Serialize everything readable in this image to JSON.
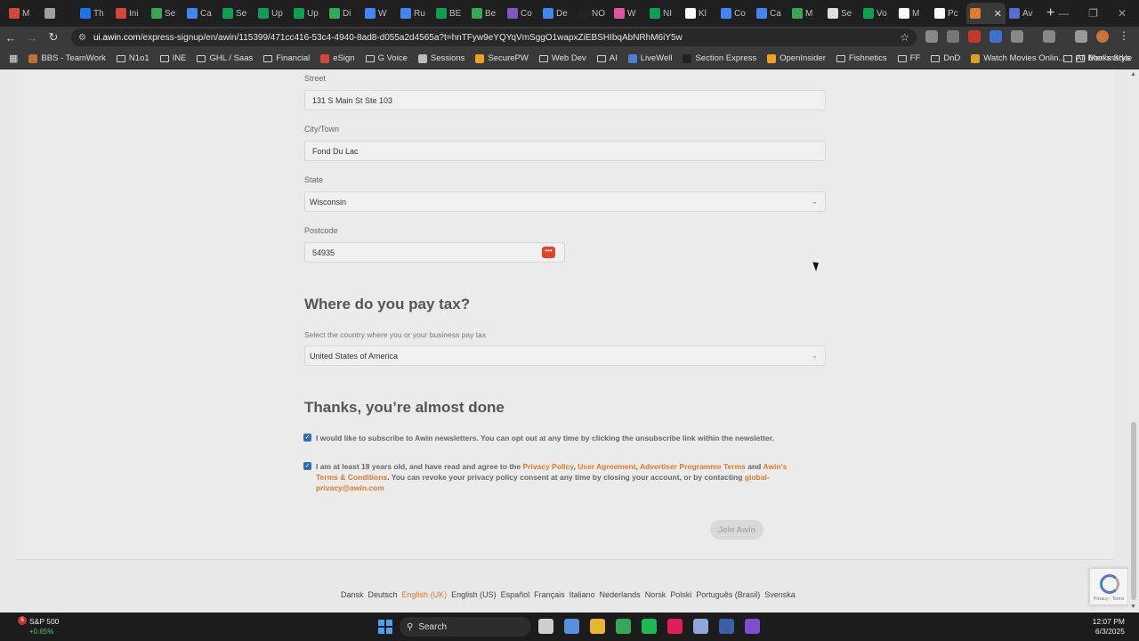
{
  "browser": {
    "tabs": [
      {
        "label": "M",
        "color": "#d44638"
      },
      {
        "label": "",
        "color": "#9aa0a6"
      },
      {
        "label": "Th",
        "color": "#1a73e8"
      },
      {
        "label": "Ini",
        "color": "#d44638"
      },
      {
        "label": "Se",
        "color": "#34a853"
      },
      {
        "label": "Ca",
        "color": "#4285f4"
      },
      {
        "label": "Se",
        "color": "#0f9d58"
      },
      {
        "label": "Up",
        "color": "#0f9d58"
      },
      {
        "label": "Up",
        "color": "#0f9d58"
      },
      {
        "label": "Di",
        "color": "#34a853"
      },
      {
        "label": "W",
        "color": "#4285f4"
      },
      {
        "label": "Ru",
        "color": "#4285f4"
      },
      {
        "label": "BE",
        "color": "#0f9d58"
      },
      {
        "label": "Be",
        "color": "#34a853"
      },
      {
        "label": "Co",
        "color": "#7e57c2"
      },
      {
        "label": "De",
        "color": "#4285f4"
      },
      {
        "label": "NO",
        "color": "#222222"
      },
      {
        "label": "W",
        "color": "#e056a0"
      },
      {
        "label": "NI",
        "color": "#0f9d58"
      },
      {
        "label": "Kl",
        "color": "#ffffff"
      },
      {
        "label": "Co",
        "color": "#4285f4"
      },
      {
        "label": "Ca",
        "color": "#4285f4"
      },
      {
        "label": "M",
        "color": "#34a853"
      },
      {
        "label": "Se",
        "color": "#dddddd"
      },
      {
        "label": "Vo",
        "color": "#0f9d58"
      },
      {
        "label": "M",
        "color": "#ffffff"
      },
      {
        "label": "Pc",
        "color": "#ffffff"
      },
      {
        "label": "",
        "color": "#e07a2c",
        "active": true
      },
      {
        "label": "Av",
        "color": "#5b6bd6"
      }
    ],
    "url_host": "ui.awin.com",
    "url_path": "/express-signup/en/awin/115399/471cc416-53c4-4940-8ad8-d055a2d4565a?t=hnTFyw9eYQYqVmSggO1wapxZiEBSHIbqAbNRhM6iY5w",
    "bookmarks": [
      {
        "label": "BBS - TeamWork",
        "type": "dot",
        "color": "#c0702c"
      },
      {
        "label": "N1o1",
        "type": "folder"
      },
      {
        "label": "INE",
        "type": "folder"
      },
      {
        "label": "GHL / Saas",
        "type": "folder"
      },
      {
        "label": "Financial",
        "type": "folder"
      },
      {
        "label": "eSign",
        "type": "dot",
        "color": "#d44638"
      },
      {
        "label": "G Voice",
        "type": "folder"
      },
      {
        "label": "Sessions",
        "type": "dot",
        "color": "#bbbbbb"
      },
      {
        "label": "SecurePW",
        "type": "dot",
        "color": "#f0a020"
      },
      {
        "label": "Web Dev",
        "type": "folder"
      },
      {
        "label": "AI",
        "type": "folder"
      },
      {
        "label": "LiveWell",
        "type": "dot",
        "color": "#4a7fd6"
      },
      {
        "label": "Section Express",
        "type": "dot",
        "color": "#222222"
      },
      {
        "label": "OpenInsider",
        "type": "dot",
        "color": "#f0a020"
      },
      {
        "label": "Fishnetics",
        "type": "folder"
      },
      {
        "label": "FF",
        "type": "folder"
      },
      {
        "label": "DnD",
        "type": "folder"
      },
      {
        "label": "Watch Movies Onlin...",
        "type": "dot",
        "color": "#e0a020"
      },
      {
        "label": "Men's Style",
        "type": "folder"
      }
    ],
    "all_bookmarks": "All Bookmarks",
    "more_bookmarks": "»"
  },
  "form": {
    "street": {
      "label": "Street",
      "value": "131 S Main St Ste 103"
    },
    "city": {
      "label": "City/Town",
      "value": "Fond Du Lac"
    },
    "state": {
      "label": "State",
      "value": "Wisconsin"
    },
    "postcode": {
      "label": "Postcode",
      "value": "54935"
    },
    "tax_heading": "Where do you pay tax?",
    "tax_sublabel": "Select the country where you or your business pay tax",
    "tax_country": "United States of America",
    "done_heading": "Thanks, you’re almost done",
    "newsletter_text": "I would like to subscribe to Awin newsletters. You can opt out at any time by clicking the unsubscribe link within the newsletter.",
    "newsletter_checked": true,
    "terms": {
      "t1": "I am at least 18 years old, and have read and agree to the ",
      "privacy_policy": "Privacy Policy",
      "sep1": ", ",
      "user_agreement": "User Agreement",
      "sep2": ", ",
      "advertiser_terms": "Advertiser Programme Terms",
      "t2": " and ",
      "awin_terms": "Awin's Terms & Conditions",
      "t3": ". You can revoke your privacy policy consent at any time by closing your account, or by contacting ",
      "email": "global-privacy@awin.com"
    },
    "terms_checked": true,
    "join_button": "Join Awin"
  },
  "languages": [
    {
      "label": "Dansk"
    },
    {
      "label": "Deutsch"
    },
    {
      "label": "English (UK)",
      "current": true
    },
    {
      "label": "English (US)"
    },
    {
      "label": "Español"
    },
    {
      "label": "Français"
    },
    {
      "label": "Italiano"
    },
    {
      "label": "Nederlands"
    },
    {
      "label": "Norsk"
    },
    {
      "label": "Polski"
    },
    {
      "label": "Português (Brasil)"
    },
    {
      "label": "Svenska"
    }
  ],
  "recaptcha": {
    "text": "Privacy - Terms"
  },
  "taskbar": {
    "stock_name": "S&P 500",
    "stock_change": "+0.65%",
    "notification_count": "6",
    "search_label": "Search",
    "apps": [
      {
        "name": "task-view",
        "color": "#cfcfcf"
      },
      {
        "name": "copilot",
        "color": "#5a8fe0"
      },
      {
        "name": "file-explorer",
        "color": "#e8b530"
      },
      {
        "name": "chrome",
        "color": "#34a853"
      },
      {
        "name": "spotify",
        "color": "#1db954"
      },
      {
        "name": "slack",
        "color": "#e01e5a"
      },
      {
        "name": "settings",
        "color": "#8fa6d8"
      },
      {
        "name": "app",
        "color": "#3c5fa8"
      },
      {
        "name": "app",
        "color": "#7b4fd0"
      }
    ],
    "time": "12:07 PM",
    "date": "6/3/2025"
  },
  "colors": {
    "accent": "#e07a2c",
    "checkbox": "#2f6fb5"
  }
}
